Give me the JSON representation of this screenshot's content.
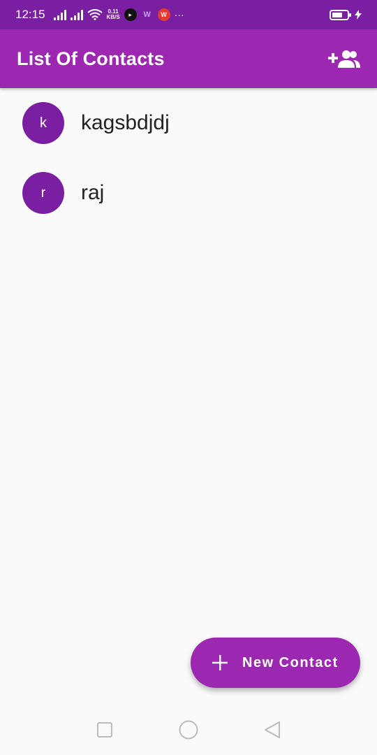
{
  "status_bar": {
    "time": "12:15",
    "net_speed_value": "0.11",
    "net_speed_unit": "KB/S",
    "more": "···",
    "battery_level": 0.7
  },
  "app_bar": {
    "title": "List Of Contacts",
    "action_icon": "group-add-icon"
  },
  "contacts": [
    {
      "initial": "k",
      "name": "kagsbdjdj"
    },
    {
      "initial": "r",
      "name": "raj"
    }
  ],
  "fab": {
    "icon": "plus-icon",
    "label": "New Contact"
  },
  "nav": {
    "items": [
      "recents-square-icon",
      "home-circle-icon",
      "back-triangle-icon"
    ]
  },
  "colors": {
    "status_bar": "#7b1fa2",
    "app_bar": "#9c27b0",
    "avatar": "#7b1fa2",
    "fab": "#9c27b0",
    "background": "#fafafa"
  }
}
